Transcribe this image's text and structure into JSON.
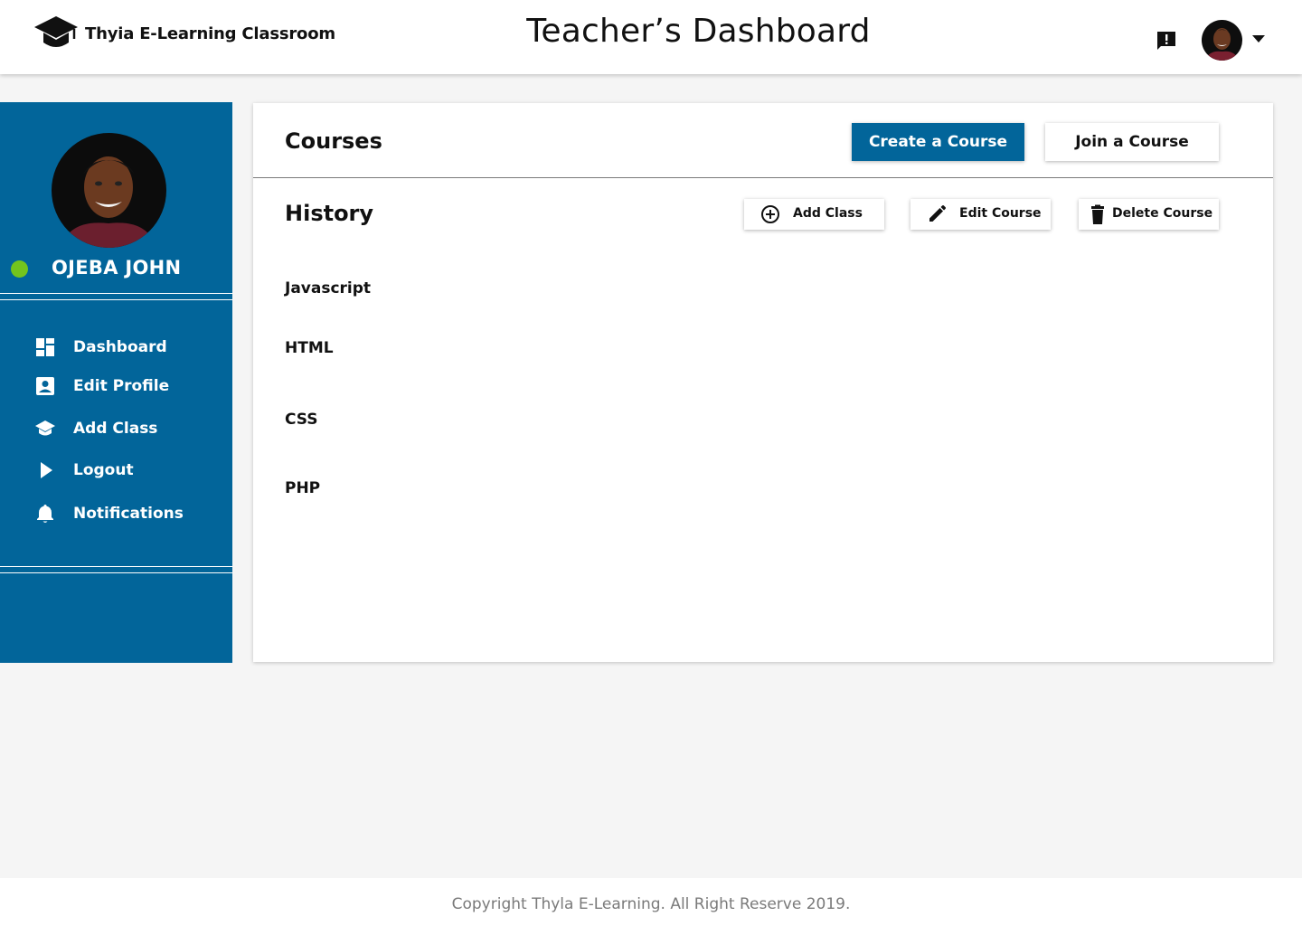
{
  "header": {
    "brand_name": "Thyia E-Learning Classroom",
    "brand_icon": "graduation-cap-icon",
    "page_title": "Teacher’s Dashboard",
    "feedback_icon": "feedback-icon",
    "avatar_alt": "user avatar",
    "dropdown_icon": "caret-down-icon"
  },
  "sidebar": {
    "user_name": "OJEBA JOHN",
    "status": "online",
    "status_color": "#73c41d",
    "items": [
      {
        "label": "Dashboard",
        "icon": "dashboard-icon"
      },
      {
        "label": "Edit Profile",
        "icon": "profile-card-icon"
      },
      {
        "label": "Add Class",
        "icon": "graduation-cap-icon"
      },
      {
        "label": "Logout",
        "icon": "play-arrow-icon"
      },
      {
        "label": "Notifications",
        "icon": "bell-icon"
      }
    ]
  },
  "main": {
    "courses_title": "Courses",
    "create_button": "Create a Course",
    "join_button": "Join a Course",
    "history_title": "History",
    "add_class_button": "Add Class",
    "edit_course_button": "Edit Course",
    "delete_course_button": "Delete Course",
    "courses": [
      "Javascript",
      "HTML",
      "CSS",
      "PHP"
    ]
  },
  "footer": {
    "copyright": "Copyright Thyla E-Learning. All Right Reserve 2019."
  },
  "colors": {
    "primary": "#02659a",
    "status_online": "#73c41d",
    "background": "#f5f5f5",
    "footer_text": "#7a7a7a"
  }
}
